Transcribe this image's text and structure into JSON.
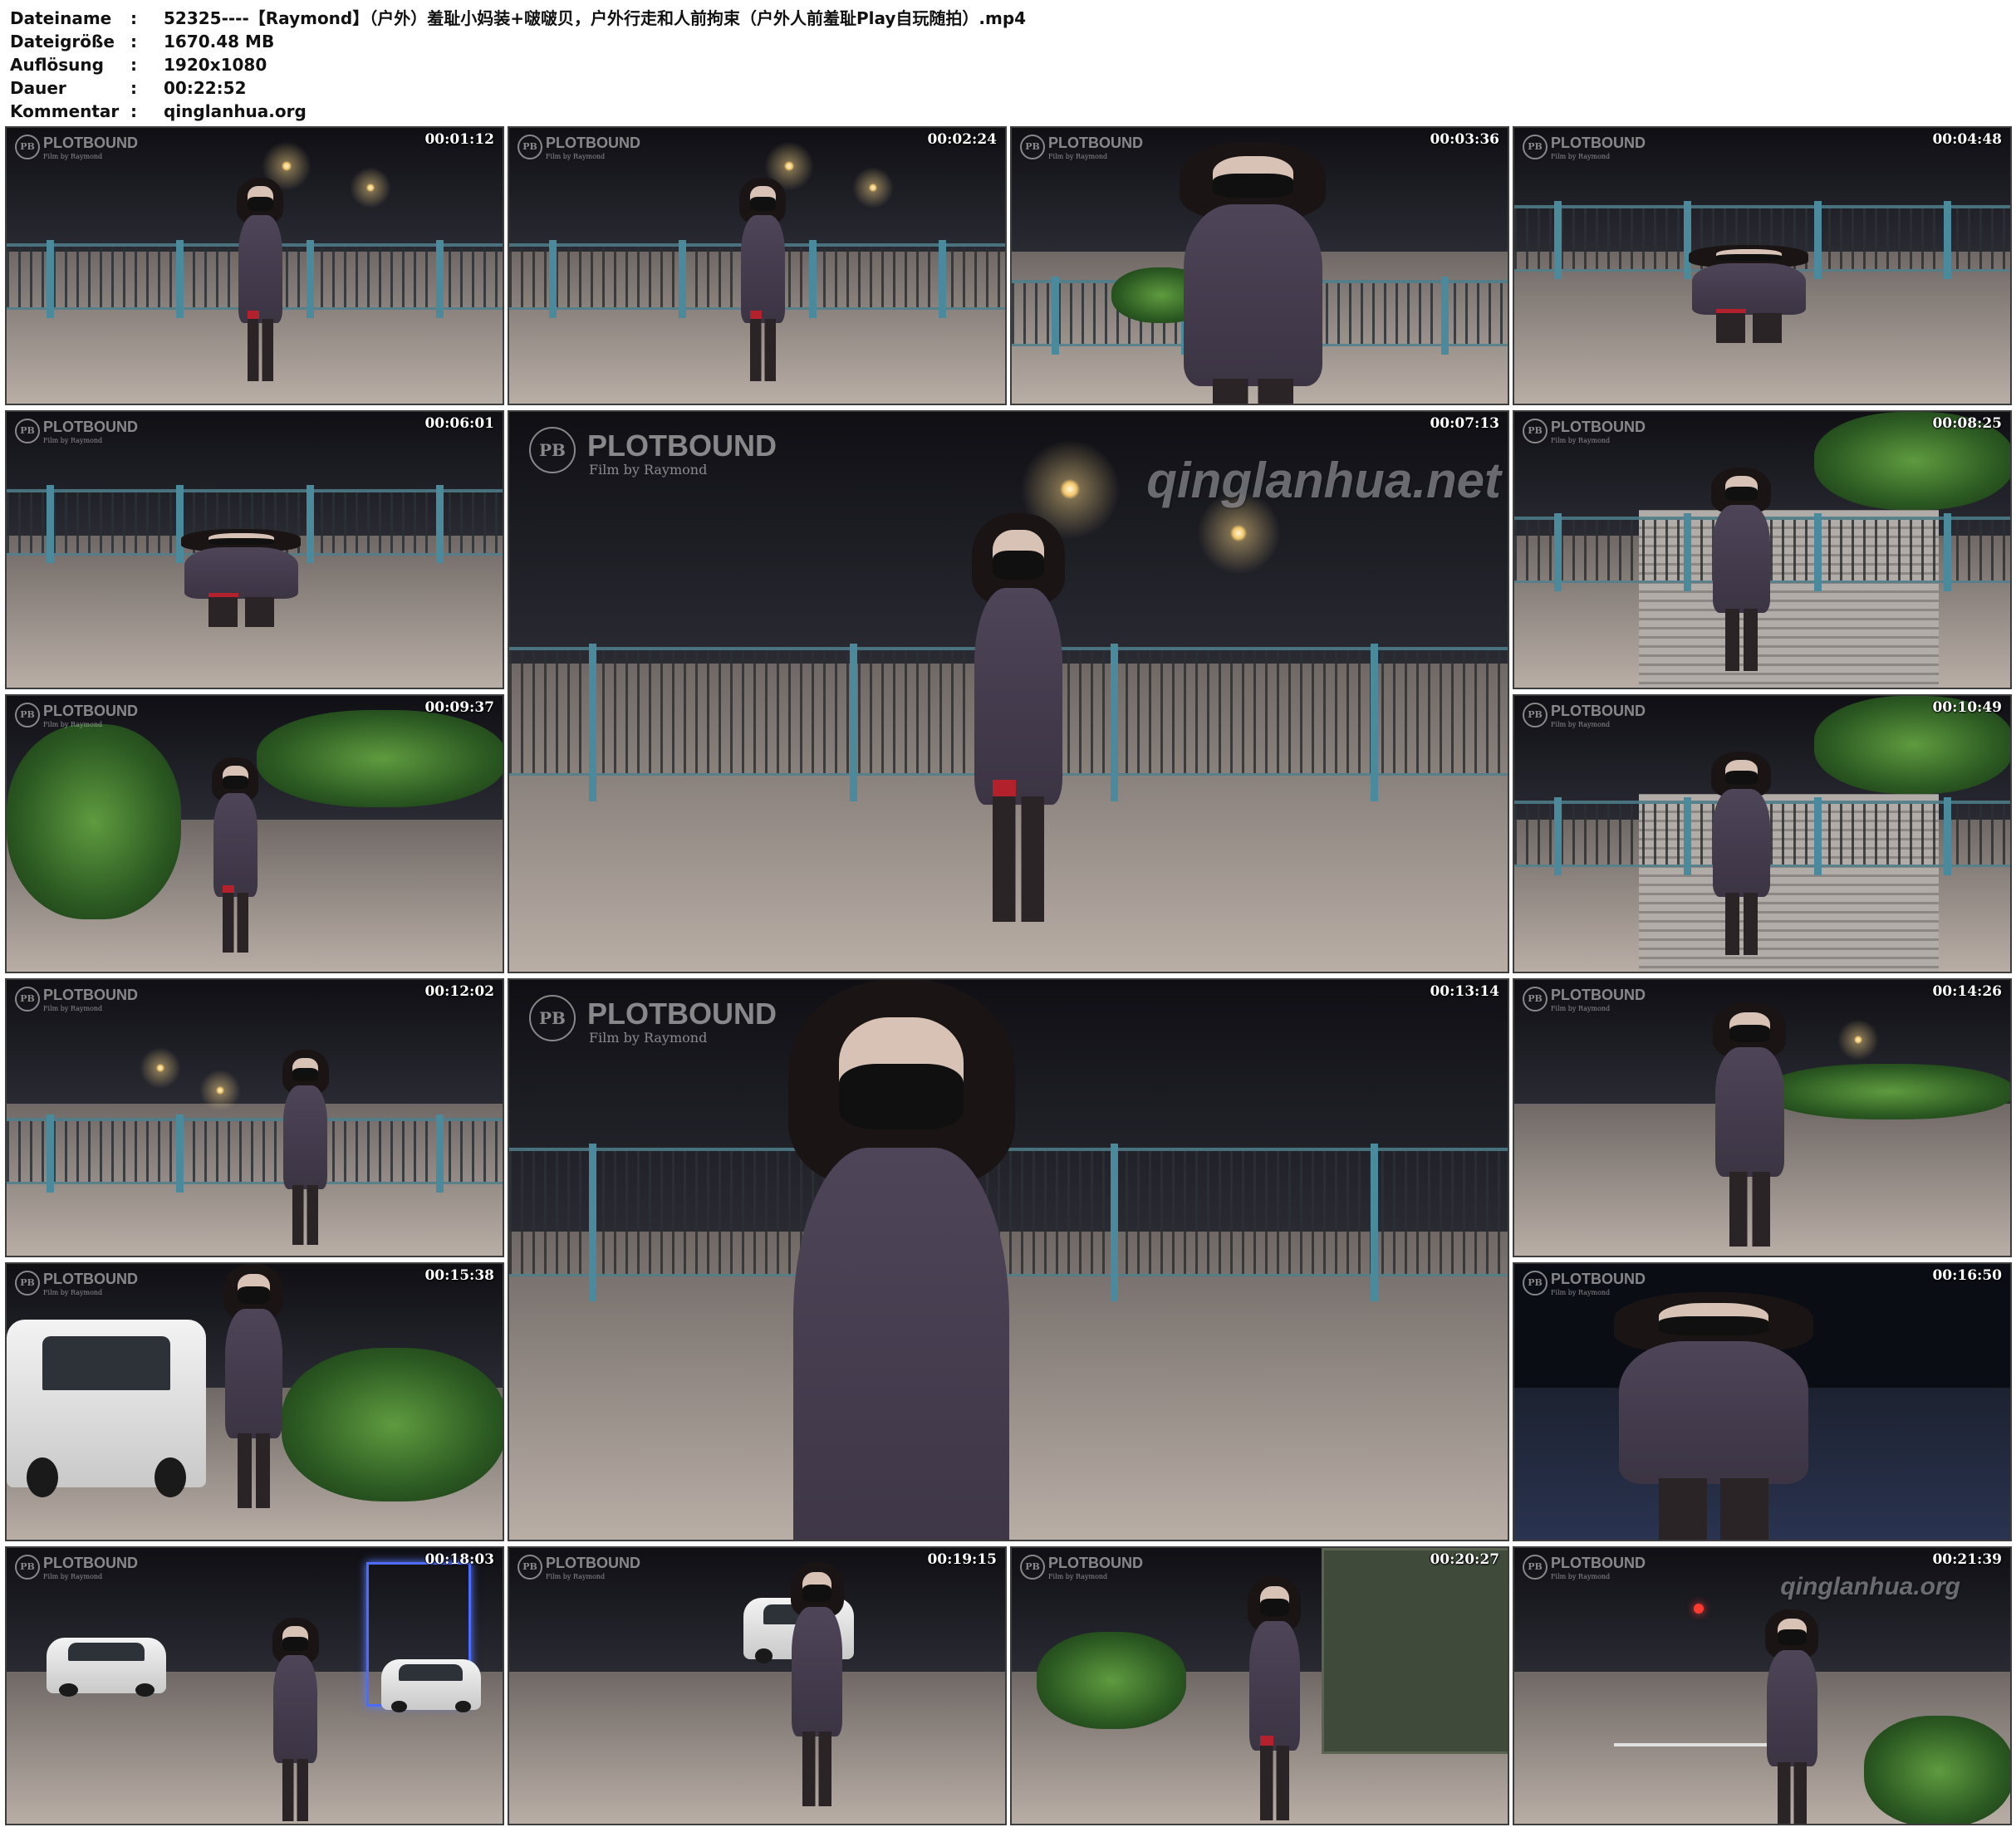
{
  "file_info": [
    {
      "key": "Dateiname",
      "value": "52325----【Raymond】（户外）羞耻小妈装+啵啵贝，户外行走和人前拘束（户外人前羞耻Play自玩随拍）.mp4"
    },
    {
      "key": "Dateigröße",
      "value": "1670.48 MB"
    },
    {
      "key": "Auflösung",
      "value": "1920x1080"
    },
    {
      "key": "Dauer",
      "value": "00:22:52"
    },
    {
      "key": "Kommentar",
      "value": "qinglanhua.org"
    }
  ],
  "separator": ":",
  "brand": {
    "mark": "PB",
    "name": "PLOTBOUND",
    "subtitle": "Film by Raymond"
  },
  "watermark_large": "qinglanhua.net",
  "watermark_small": "qinglanhua.org",
  "thumbnails": [
    {
      "timestamp": "00:01:12",
      "scene": "bridge-night-walk"
    },
    {
      "timestamp": "00:02:24",
      "scene": "bridge-night-stand"
    },
    {
      "timestamp": "00:03:36",
      "scene": "closeup-mask"
    },
    {
      "timestamp": "00:04:48",
      "scene": "bridge-crawl"
    },
    {
      "timestamp": "00:06:01",
      "scene": "bridge-crawl"
    },
    {
      "timestamp": "00:07:13",
      "scene": "bridge-night-walk-large"
    },
    {
      "timestamp": "00:08:25",
      "scene": "stairs-railing"
    },
    {
      "timestamp": "00:09:37",
      "scene": "street-foliage"
    },
    {
      "timestamp": "00:10:49",
      "scene": "stairs-back"
    },
    {
      "timestamp": "00:12:02",
      "scene": "bridge-road-view"
    },
    {
      "timestamp": "00:13:14",
      "scene": "bridge-closeup-large"
    },
    {
      "timestamp": "00:14:26",
      "scene": "street-night"
    },
    {
      "timestamp": "00:15:38",
      "scene": "parked-car"
    },
    {
      "timestamp": "00:16:50",
      "scene": "car-interior"
    },
    {
      "timestamp": "00:18:03",
      "scene": "parking-neon"
    },
    {
      "timestamp": "00:19:15",
      "scene": "parking-lot"
    },
    {
      "timestamp": "00:20:27",
      "scene": "street-truck"
    },
    {
      "timestamp": "00:21:39",
      "scene": "road-traffic"
    }
  ]
}
